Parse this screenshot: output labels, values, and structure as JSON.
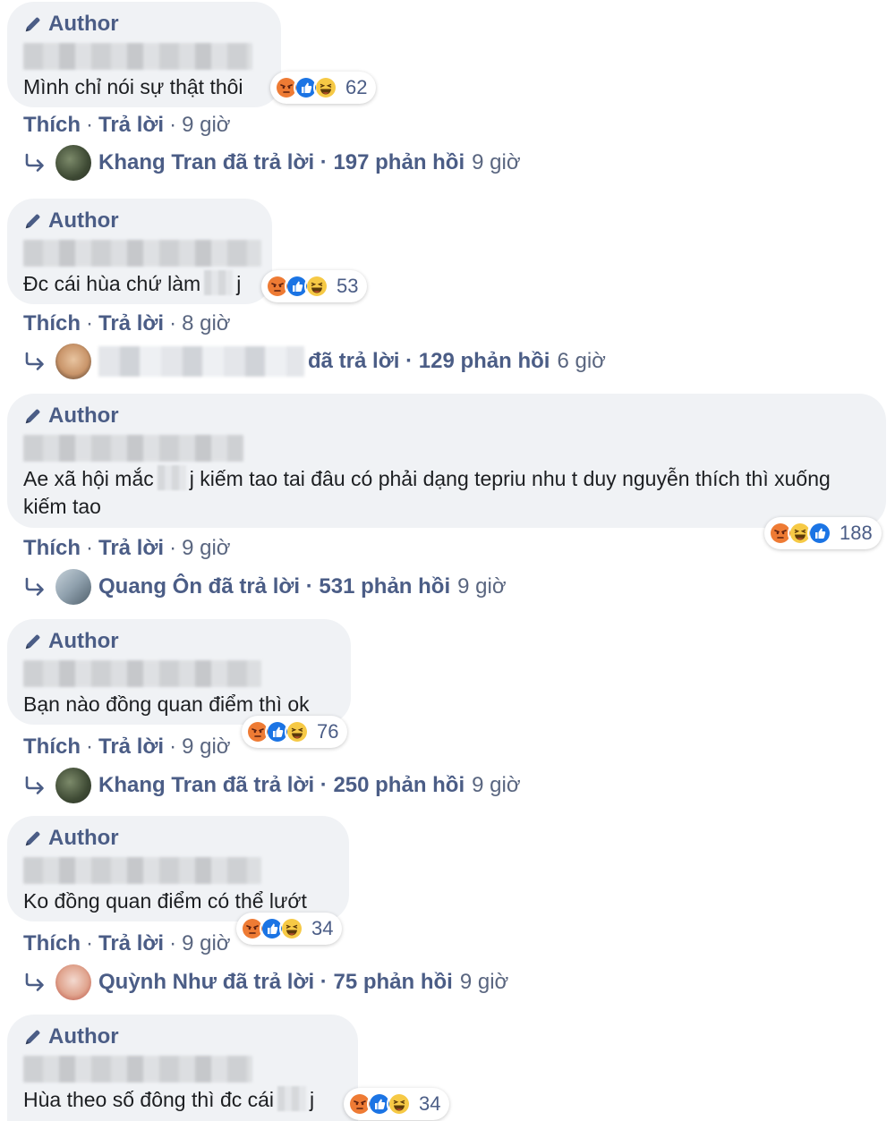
{
  "comments": [
    {
      "author_label": "Author",
      "text": "Mình chỉ nói sự thật thôi",
      "reaction_count": "62",
      "actions": {
        "like": "Thích",
        "reply": "Trả lời",
        "dot": "·",
        "time": "9 giờ"
      },
      "reply": {
        "name": "Khang Tran",
        "summary": "đã trả lời · 197 phản hồi",
        "time": "9 giờ",
        "avatar": "avatar-soldier"
      }
    },
    {
      "author_label": "Author",
      "text_before": "Đc cái hùa chứ làm",
      "text_after": "j",
      "reaction_count": "53",
      "actions": {
        "like": "Thích",
        "reply": "Trả lời",
        "dot": "·",
        "time": "8 giờ"
      },
      "reply": {
        "name": "",
        "summary": "đã trả lời · 129 phản hồi",
        "time": "6 giờ",
        "avatar": "avatar-face"
      }
    },
    {
      "author_label": "Author",
      "text_before": "Ae xã hội mắc",
      "text_after": "j kiếm tao tai đâu có phải dạng tepriu nhu t duy nguyễn thích thì xuống kiếm tao",
      "reaction_count": "188",
      "actions": {
        "like": "Thích",
        "reply": "Trả lời",
        "dot": "·",
        "time": "9 giờ"
      },
      "reply": {
        "name": "Quang Ôn",
        "summary": "đã trả lời · 531 phản hồi",
        "time": "9 giờ",
        "avatar": "avatar-group"
      }
    },
    {
      "author_label": "Author",
      "text": "Bạn nào đồng quan điểm thì ok",
      "reaction_count": "76",
      "actions": {
        "like": "Thích",
        "reply": "Trả lời",
        "dot": "·",
        "time": "9 giờ"
      },
      "reply": {
        "name": "Khang Tran",
        "summary": "đã trả lời · 250 phản hồi",
        "time": "9 giờ",
        "avatar": "avatar-soldier"
      }
    },
    {
      "author_label": "Author",
      "text": "Ko đồng quan điểm có thể lướt",
      "reaction_count": "34",
      "actions": {
        "like": "Thích",
        "reply": "Trả lời",
        "dot": "·",
        "time": "9 giờ"
      },
      "reply": {
        "name": "Quỳnh Như",
        "summary": "đã trả lời · 75 phản hồi",
        "time": "9 giờ",
        "avatar": "avatar-cartoon"
      }
    },
    {
      "author_label": "Author",
      "text_before": "Hùa theo số đông thì đc cái",
      "text_after": "j",
      "reaction_count": "34"
    }
  ],
  "icons": {
    "author": "pen-icon",
    "reactions": [
      "angry-reaction-icon",
      "like-reaction-icon",
      "haha-reaction-icon"
    ],
    "reply": "reply-arrow-icon"
  },
  "colors": {
    "link": "#4b5d86",
    "bubble": "#f0f2f5",
    "like": "#1b74e4"
  }
}
